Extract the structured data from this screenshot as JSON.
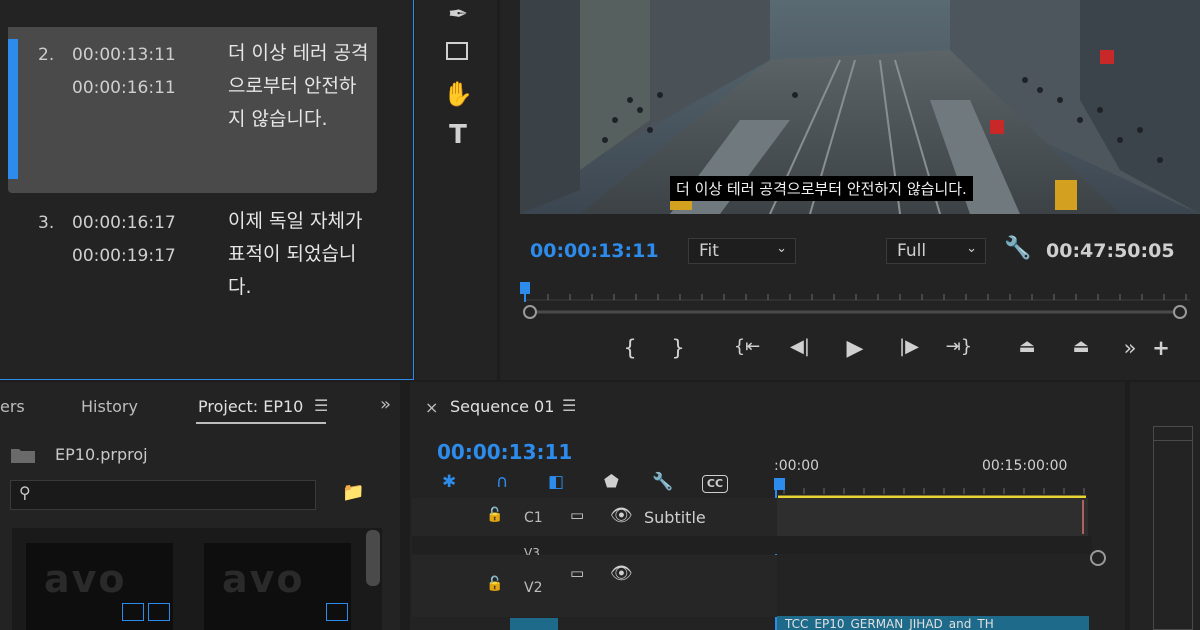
{
  "captions": [
    {
      "num": "2.",
      "in": "00:00:13:11",
      "out": "00:00:16:11",
      "text": "더 이상 테러 공격으로부터 안전하지 않습니다."
    },
    {
      "num": "3.",
      "in": "00:00:16:17",
      "out": "00:00:19:17",
      "text": "이제 독일 자체가 표적이 되었습니다."
    }
  ],
  "monitor": {
    "subtitle": "더 이상 테러 공격으로부터 안전하지 않습니다.",
    "current_tc": "00:00:13:11",
    "zoom": "Fit",
    "quality": "Full",
    "duration": "00:47:50:05"
  },
  "project": {
    "tab_partial": "ers",
    "tab_history": "History",
    "tab_project": "Project: EP10",
    "file_name": "EP10.prproj",
    "search_placeholder": ""
  },
  "sequence": {
    "tab_name": "Sequence 01",
    "current_tc": "00:00:13:11",
    "ruler_start": ":00:00",
    "ruler_mid": "00:15:00:00",
    "tracks": {
      "c1": "C1",
      "c1_name": "Subtitle",
      "v3": "V3",
      "v2": "V2"
    },
    "clip_name": "TCC_EP10_GERMAN_JIHAD_and_TH"
  },
  "colors": {
    "accent": "#2d8ceb",
    "yellow": "#e8d432",
    "clip": "#1d6a8a"
  },
  "icons": [
    "pen-icon",
    "rectangle-icon",
    "hand-icon",
    "type-icon",
    "wrench-icon",
    "mark-in-icon",
    "mark-out-icon",
    "go-to-in-icon",
    "step-back-icon",
    "play-icon",
    "step-forward-icon",
    "go-to-out-icon",
    "lift-icon",
    "extract-icon",
    "more-icon",
    "add-icon",
    "snap-icon",
    "magnet-icon",
    "linked-icon",
    "marker-icon",
    "captions-icon",
    "lock-icon",
    "eye-icon",
    "toggle-output-icon"
  ]
}
